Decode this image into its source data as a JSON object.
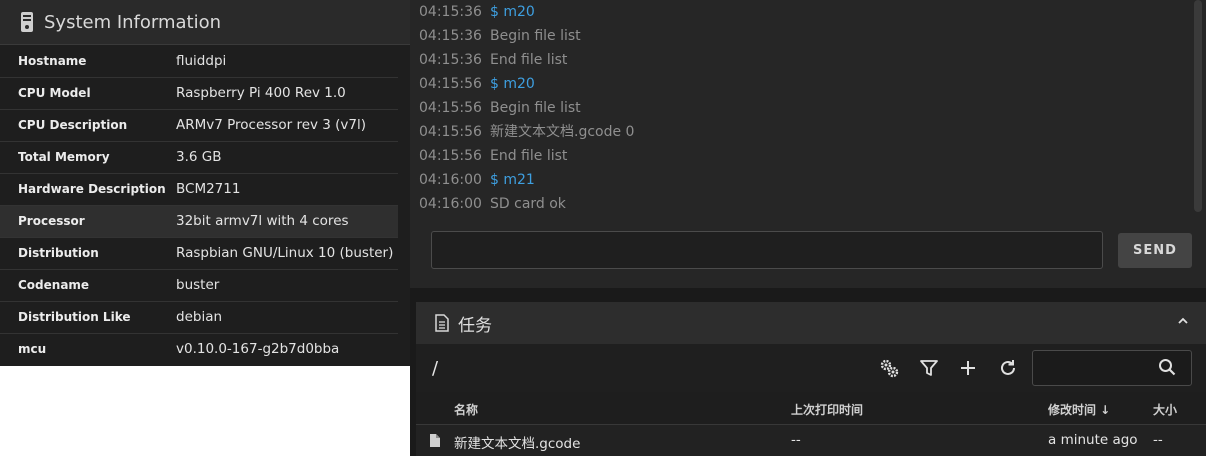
{
  "system_info": {
    "title": "System Information",
    "icon": "raspberry-pi-device-icon",
    "rows": [
      {
        "key": "Hostname",
        "value": "fluiddpi"
      },
      {
        "key": "CPU Model",
        "value": "Raspberry Pi 400 Rev 1.0"
      },
      {
        "key": "CPU Description",
        "value": "ARMv7 Processor rev 3 (v7l)"
      },
      {
        "key": "Total Memory",
        "value": "3.6 GB"
      },
      {
        "key": "Hardware Description",
        "value": "BCM2711"
      },
      {
        "key": "Processor",
        "value": "32bit armv7l with 4 cores"
      },
      {
        "key": "Distribution",
        "value": "Raspbian GNU/Linux 10 (buster)"
      },
      {
        "key": "Codename",
        "value": "buster"
      },
      {
        "key": "Distribution Like",
        "value": "debian"
      },
      {
        "key": "mcu",
        "value": "v0.10.0-167-g2b7d0bba"
      }
    ]
  },
  "console": {
    "log": [
      {
        "time": "04:15:36",
        "msg": "$ m20",
        "type": "command"
      },
      {
        "time": "04:15:36",
        "msg": "Begin file list",
        "type": "response"
      },
      {
        "time": "04:15:36",
        "msg": "End file list",
        "type": "response"
      },
      {
        "time": "04:15:56",
        "msg": "$ m20",
        "type": "command"
      },
      {
        "time": "04:15:56",
        "msg": "Begin file list",
        "type": "response"
      },
      {
        "time": "04:15:56",
        "msg": "新建文本文档.gcode 0",
        "type": "response"
      },
      {
        "time": "04:15:56",
        "msg": "End file list",
        "type": "response"
      },
      {
        "time": "04:16:00",
        "msg": "$ m21",
        "type": "command"
      },
      {
        "time": "04:16:00",
        "msg": "SD card ok",
        "type": "response"
      }
    ],
    "input_value": "",
    "send_label": "SEND"
  },
  "jobs": {
    "title": "任务",
    "path": "/",
    "search_value": "",
    "columns": {
      "name": "名称",
      "last_printed": "上次打印时间",
      "modified": "修改时间 ↓",
      "size": "大小"
    },
    "files": [
      {
        "name": "新建文本文档.gcode",
        "last_printed": "--",
        "modified": "a minute ago",
        "size": "--"
      }
    ]
  },
  "colors": {
    "command_text": "#3e9fe0",
    "log_text": "#8f8f8f",
    "panel_bg": "#262626"
  }
}
